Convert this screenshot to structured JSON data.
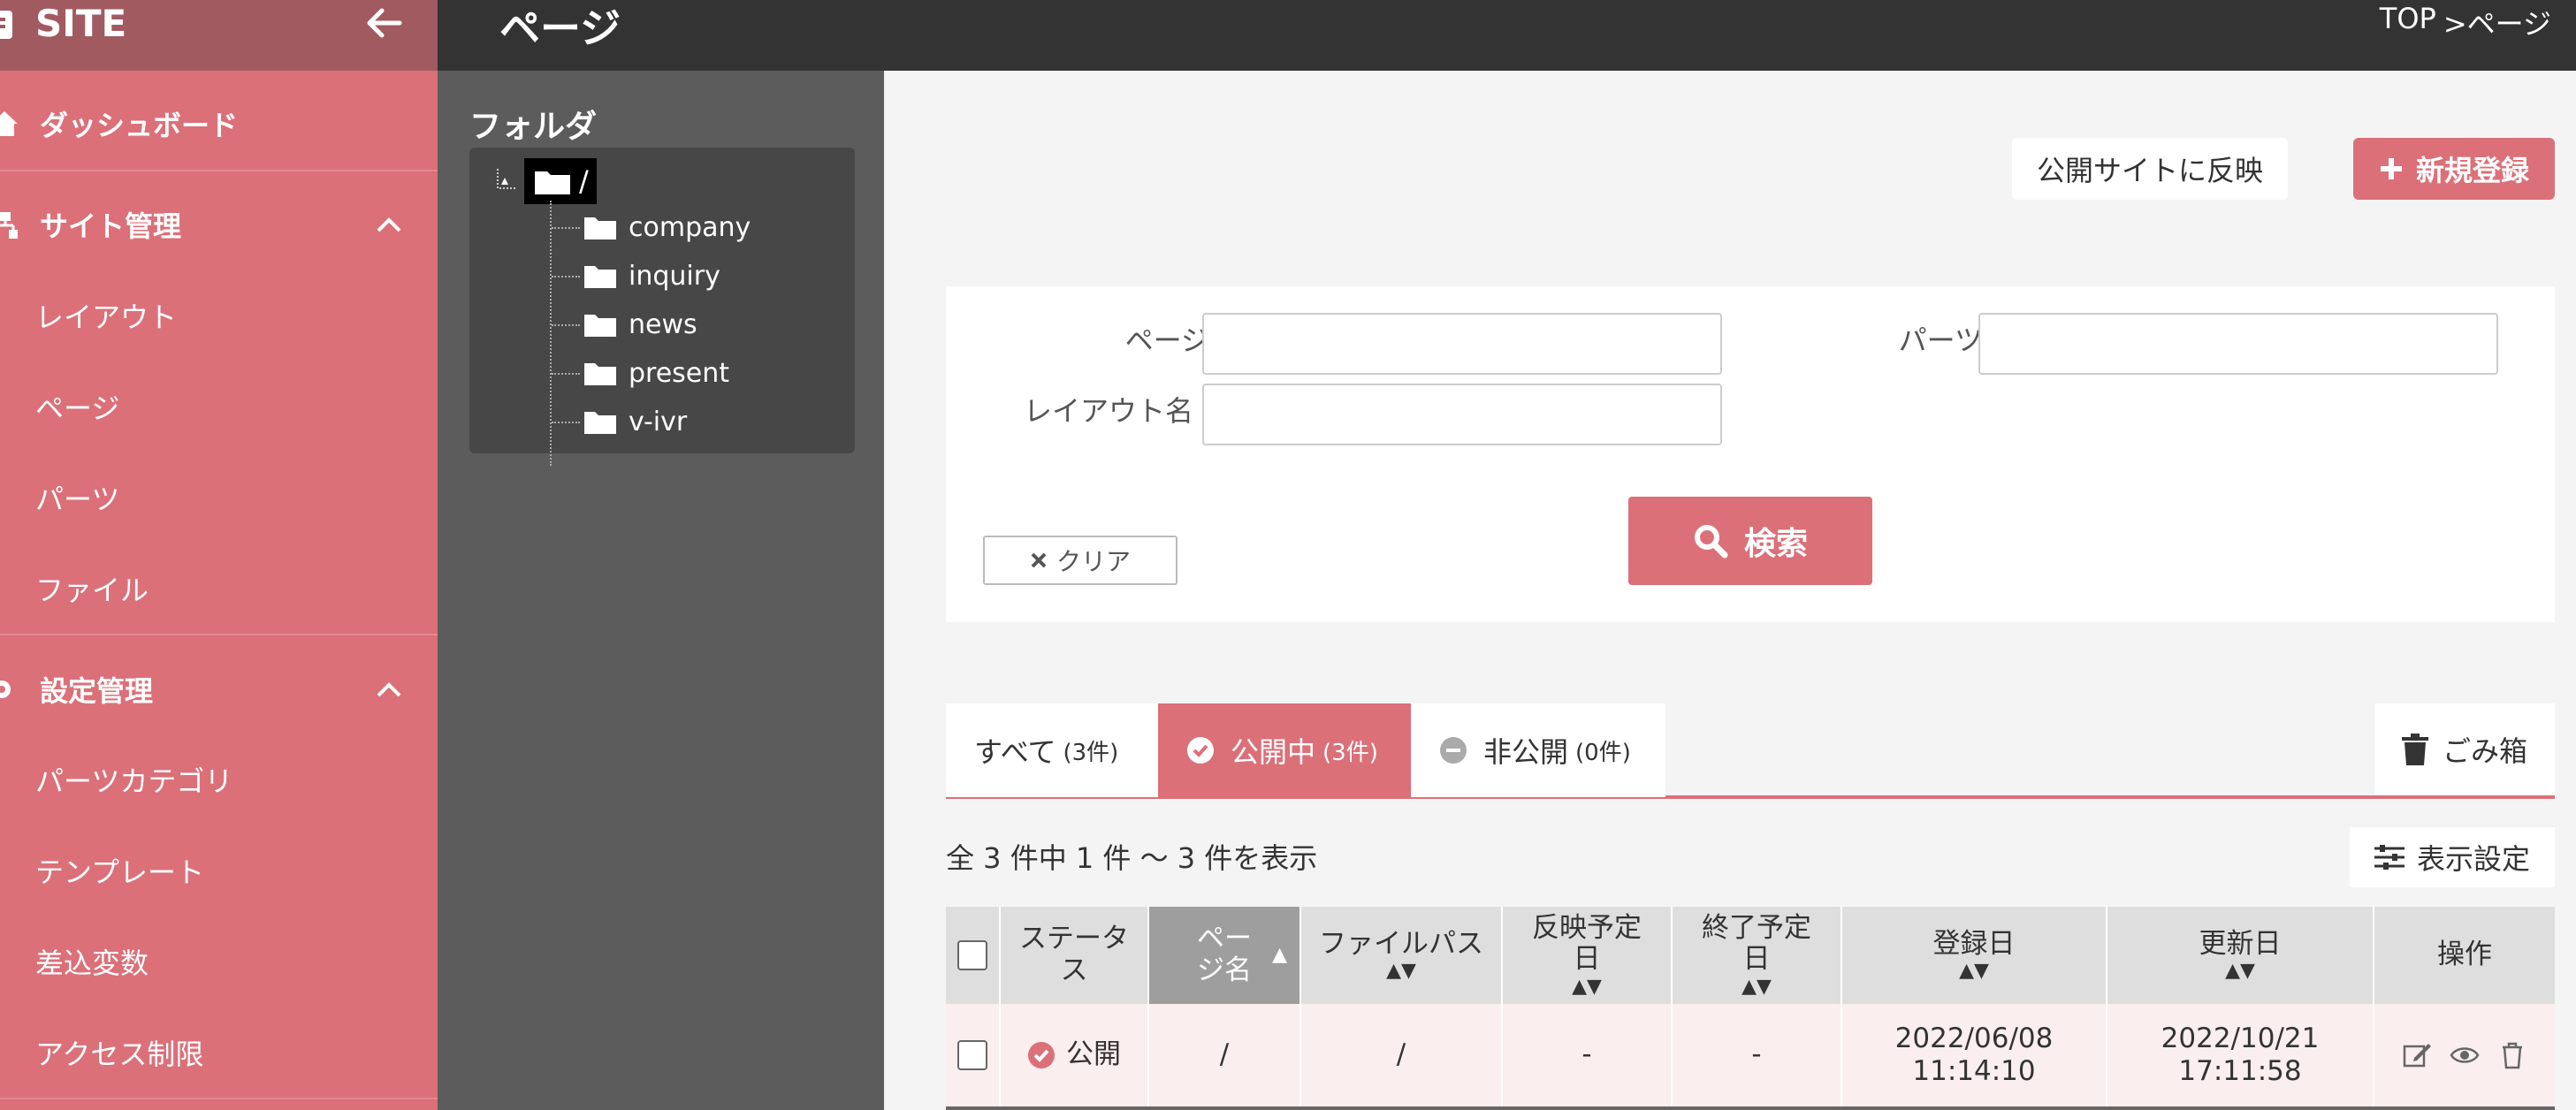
{
  "sidebar": {
    "title": "SITE",
    "items": [
      {
        "label": "ダッシュボード"
      },
      {
        "label": "サイト管理"
      },
      {
        "label": "レイアウト"
      },
      {
        "label": "ページ"
      },
      {
        "label": "パーツ"
      },
      {
        "label": "ファイル"
      },
      {
        "label": "設定管理"
      },
      {
        "label": "パーツカテゴリ"
      },
      {
        "label": "テンプレート"
      },
      {
        "label": "差込変数"
      },
      {
        "label": "アクセス制限"
      }
    ]
  },
  "header": {
    "title": "ページ",
    "breadcrumb": [
      "TOP",
      ">ページ"
    ]
  },
  "folder": {
    "title": "フォルダ",
    "root": "/",
    "items": [
      "company",
      "inquiry",
      "news",
      "present",
      "v-ivr"
    ]
  },
  "actions": {
    "reflect": "公開サイトに反映",
    "new": "新規登録"
  },
  "search": {
    "page_name_label": "ページ名",
    "page_name_value": "",
    "parts_name_label": "パーツ名",
    "parts_name_value": "",
    "layout_name_label": "レイアウト名",
    "layout_name_value": "",
    "clear": "クリア",
    "submit": "検索"
  },
  "tabs": [
    {
      "label": "すべて",
      "count": "(3件)"
    },
    {
      "label": "公開中",
      "count": "(3件)"
    },
    {
      "label": "非公開",
      "count": "(0件)"
    }
  ],
  "trash": "ごみ箱",
  "count_text": "全 3 件中 1 件 〜 3 件を表示",
  "display_settings": "表示設定",
  "table": {
    "headers": [
      "ステータス",
      "ページ名",
      "ファイルパス",
      "反映予定日",
      "終了予定日",
      "登録日",
      "更新日",
      "操作"
    ],
    "rows": [
      {
        "status": "公開",
        "page_name": "/",
        "file_path": "/",
        "reflect_date": "-",
        "end_date": "-",
        "created_date": "2022/06/08",
        "created_time": "11:14:10",
        "updated_date": "2022/10/21",
        "updated_time": "17:11:58"
      }
    ]
  },
  "colors": {
    "accent": "#db7079",
    "topbar": "#333333",
    "folder_panel": "#5c5c5c"
  }
}
